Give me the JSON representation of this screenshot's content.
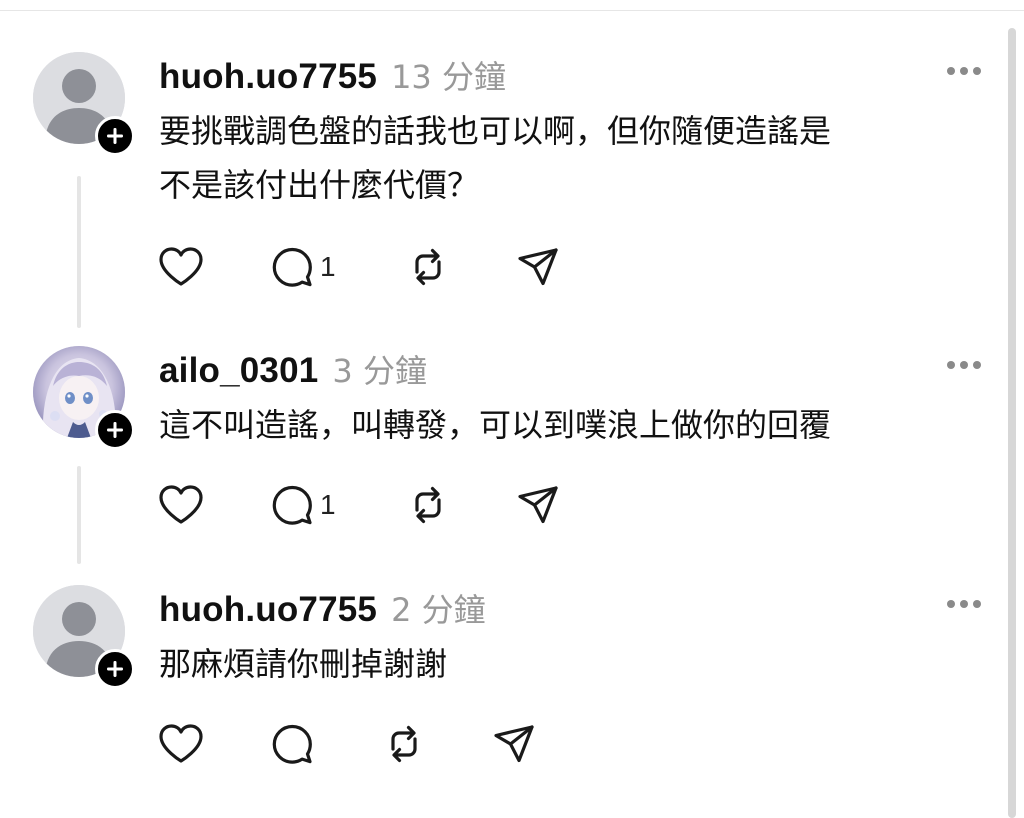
{
  "posts": [
    {
      "username": "huoh.uo7755",
      "time": "13 分鐘",
      "lines": [
        "要挑戰調色盤的話我也可以啊，但你隨便造謠是",
        "不是該付出什麼代價？"
      ],
      "reply_count": "1",
      "avatar": "default-avatar-icon"
    },
    {
      "username": "ailo_0301",
      "time": "3 分鐘",
      "lines": [
        "這不叫造謠，叫轉發，可以到噗浪上做你的回覆"
      ],
      "reply_count": "1",
      "avatar": "anime-avatar"
    },
    {
      "username": "huoh.uo7755",
      "time": "2 分鐘",
      "lines": [
        "那麻煩請你刪掉謝謝"
      ],
      "reply_count": "",
      "avatar": "default-avatar-icon"
    }
  ],
  "icons": {
    "like": "heart-icon",
    "reply": "comment-icon",
    "repost": "repost-icon",
    "share": "send-icon",
    "more": "more-icon",
    "follow": "plus-icon"
  },
  "colors": {
    "text": "#111111",
    "muted": "#999999",
    "thread_line": "#e5e5e5",
    "avatar_bg": "#dcdde1",
    "avatar_fg": "#8e9097"
  }
}
